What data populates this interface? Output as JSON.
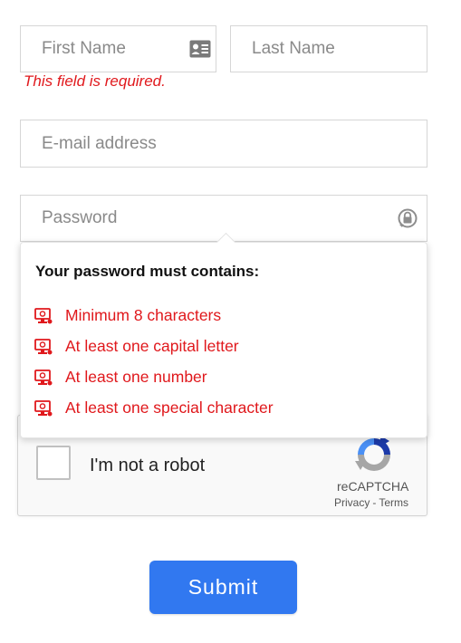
{
  "form": {
    "first_name": {
      "placeholder": "First Name",
      "icon": "contact-card-icon"
    },
    "first_name_error": "This field is required.",
    "last_name": {
      "placeholder": "Last Name"
    },
    "email": {
      "placeholder": "E-mail address"
    },
    "password": {
      "placeholder": "Password",
      "icon": "lock-icon"
    },
    "submit_label": "Submit"
  },
  "password_popover": {
    "title": "Your password must contains:",
    "rules": [
      {
        "label": "Minimum 8 characters",
        "icon": "monitor-alert-icon"
      },
      {
        "label": "At least one capital letter",
        "icon": "monitor-alert-icon"
      },
      {
        "label": "At least one number",
        "icon": "monitor-alert-icon"
      },
      {
        "label": "At least one special character",
        "icon": "monitor-alert-icon"
      }
    ]
  },
  "recaptcha": {
    "label": "I'm not a robot",
    "brand": "reCAPTCHA",
    "privacy": "Privacy",
    "separator": "-",
    "terms": "Terms",
    "checked": false
  },
  "colors": {
    "error": "#e0181c",
    "submit": "#3178f0",
    "border": "#d6d6d6"
  }
}
